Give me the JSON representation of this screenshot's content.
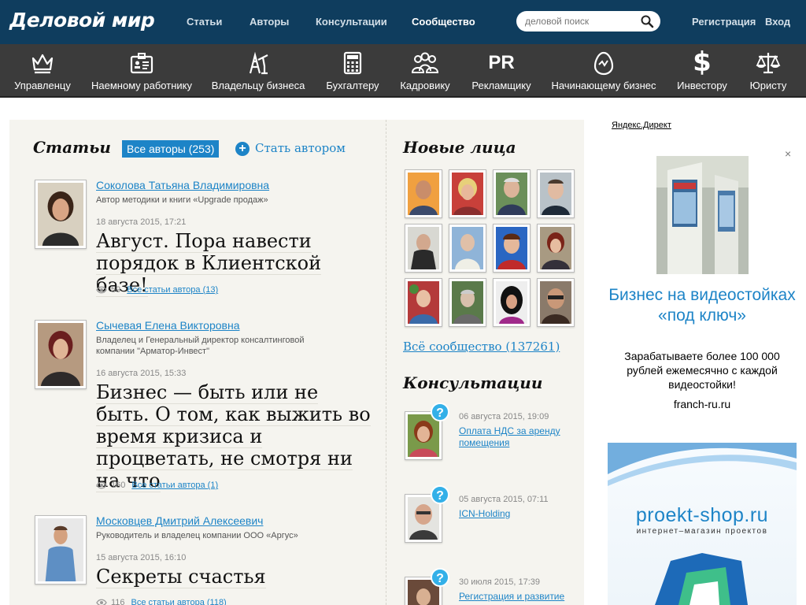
{
  "header": {
    "logo": "Деловой мир",
    "nav": [
      "Статьи",
      "Авторы",
      "Консультации",
      "Сообщество"
    ],
    "search_placeholder": "деловой поиск",
    "register": "Регистрация",
    "login": "Вход"
  },
  "categories": [
    {
      "label": "Управленцу",
      "icon": "crown-icon"
    },
    {
      "label": "Наемному работнику",
      "icon": "id-card-icon"
    },
    {
      "label": "Владельцу бизнеса",
      "icon": "oil-rig-icon"
    },
    {
      "label": "Бухгалтеру",
      "icon": "calculator-icon"
    },
    {
      "label": "Кадровику",
      "icon": "people-icon"
    },
    {
      "label": "Рекламщику",
      "icon": "pr-icon",
      "glyph": "PR"
    },
    {
      "label": "Начинающему бизнес",
      "icon": "egg-icon"
    },
    {
      "label": "Инвестору",
      "icon": "dollar-icon",
      "glyph": "$"
    },
    {
      "label": "Юристу",
      "icon": "scales-icon"
    }
  ],
  "articles": {
    "heading": "Статьи",
    "all_authors": "Все авторы (253)",
    "become_author": "Стать автором",
    "items": [
      {
        "author": "Соколова Татьяна Владимировна",
        "role": "Автор методики и книги «Upgrade продаж»",
        "date": "18 августа 2015, 17:21",
        "title": "Август. Пора навести порядок в Клиентской базе!",
        "views": "59",
        "author_articles": "Все статьи автора (13)"
      },
      {
        "author": "Сычевая Елена Викторовна",
        "role": "Владелец и Генеральный директор консалтинговой компании \"Арматор-Инвест\"",
        "date": "16 августа 2015, 15:33",
        "title": "Бизнес — быть или не быть. О том, как выжить во время кризиса и процветать, не смотря ни на что",
        "views": "160",
        "author_articles": "Все статьи автора (1)"
      },
      {
        "author": "Московцев Дмитрий Алексеевич",
        "role": "Руководитель и владелец компании ООО «Аргус»",
        "date": "15 августа 2015, 16:10",
        "title": "Секреты счастья",
        "views": "116",
        "author_articles": "Все статьи автора (118)"
      }
    ]
  },
  "new_faces": {
    "heading": "Новые лица",
    "all_community": "Всё сообщество (137261)"
  },
  "consultations": {
    "heading": "Консультации",
    "items": [
      {
        "date": "06 августа 2015, 19:09",
        "title": "Оплата НДС за аренду помещения"
      },
      {
        "date": "05 августа 2015, 07:11",
        "title": "ICN-Holding"
      },
      {
        "date": "30 июля 2015, 17:39",
        "title": "Регистрация и развитие"
      }
    ]
  },
  "ads": {
    "label": "Яндекс.Директ",
    "close": "×",
    "title": "Бизнес на видеостойках «под ключ»",
    "description": "Зарабатываете более 100 000 рублей ежемесячно с каждой видеостойки!",
    "domain": "franch-ru.ru",
    "banner_site": "proekt-shop.ru",
    "banner_sub": "интернет–магазин проектов"
  },
  "colors": {
    "header_bg": "#0f3d5e",
    "category_bg": "#3b3b3b",
    "link": "#1d84c7",
    "content_bg": "#f5f4ef"
  }
}
